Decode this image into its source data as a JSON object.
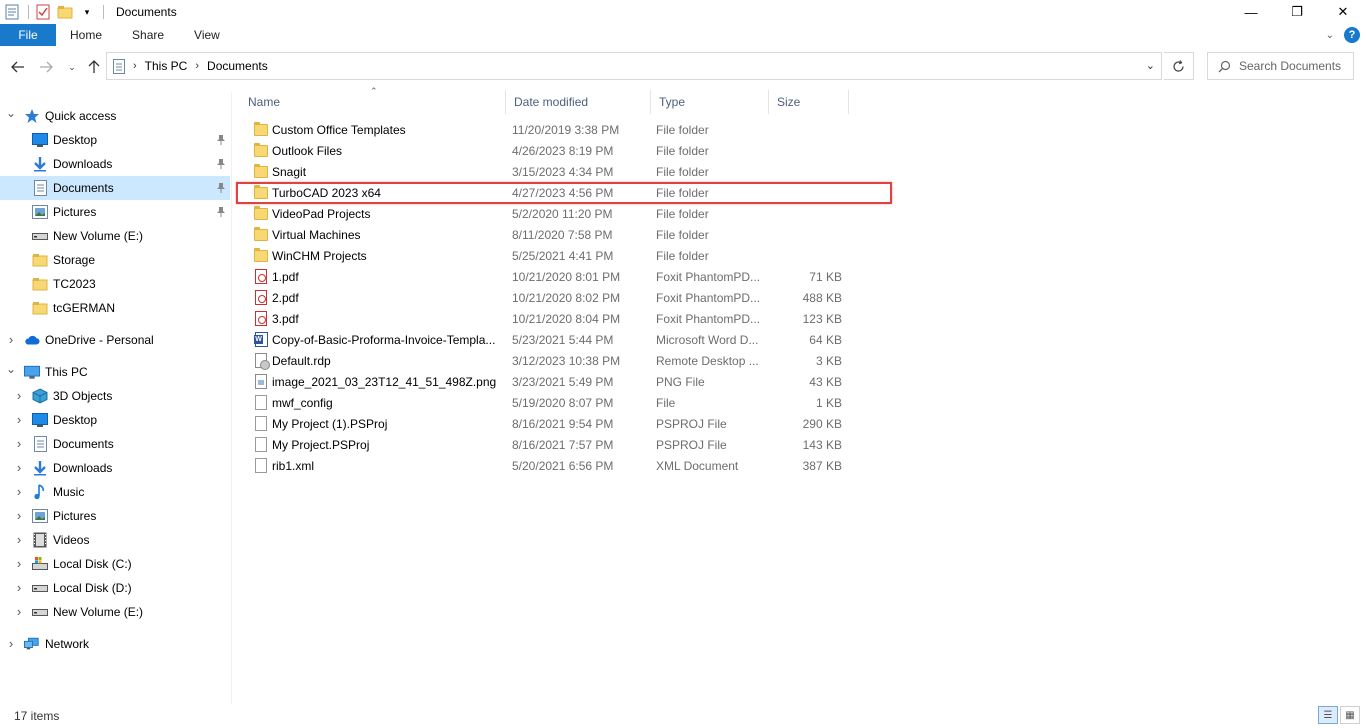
{
  "window": {
    "title": "Documents",
    "minimize": "—",
    "restore": "❐",
    "close": "✕"
  },
  "ribbon": {
    "tabs": [
      "File",
      "Home",
      "Share",
      "View"
    ],
    "help": "?"
  },
  "address": {
    "crumbs": [
      "This PC",
      "Documents"
    ],
    "search_placeholder": "Search Documents"
  },
  "navpane": {
    "items": [
      {
        "label": "Quick access",
        "icon": "star-icon",
        "level": 0,
        "expand": "open"
      },
      {
        "label": "Desktop",
        "icon": "desktop-icon",
        "level": 1,
        "pinned": true
      },
      {
        "label": "Downloads",
        "icon": "download-icon",
        "level": 1,
        "pinned": true
      },
      {
        "label": "Documents",
        "icon": "documents-icon",
        "level": 1,
        "pinned": true,
        "selected": true
      },
      {
        "label": "Pictures",
        "icon": "pictures-icon",
        "level": 1,
        "pinned": true
      },
      {
        "label": "New Volume (E:)",
        "icon": "drive-icon",
        "level": 1
      },
      {
        "label": "Storage",
        "icon": "folder-icon",
        "level": 1
      },
      {
        "label": "TC2023",
        "icon": "folder-icon",
        "level": 1
      },
      {
        "label": "tcGERMAN",
        "icon": "folder-icon",
        "level": 1
      },
      {
        "label": "OneDrive - Personal",
        "icon": "cloud-icon",
        "level": 0,
        "expand": "closed"
      },
      {
        "label": "This PC",
        "icon": "computer-icon",
        "level": 0,
        "expand": "open"
      },
      {
        "label": "3D Objects",
        "icon": "cube-icon",
        "level": 1,
        "expand": "closed"
      },
      {
        "label": "Desktop",
        "icon": "desktop-icon",
        "level": 1,
        "expand": "closed"
      },
      {
        "label": "Documents",
        "icon": "documents-icon",
        "level": 1,
        "expand": "closed"
      },
      {
        "label": "Downloads",
        "icon": "download-icon",
        "level": 1,
        "expand": "closed"
      },
      {
        "label": "Music",
        "icon": "music-icon",
        "level": 1,
        "expand": "closed"
      },
      {
        "label": "Pictures",
        "icon": "pictures-icon",
        "level": 1,
        "expand": "closed"
      },
      {
        "label": "Videos",
        "icon": "video-icon",
        "level": 1,
        "expand": "closed"
      },
      {
        "label": "Local Disk (C:)",
        "icon": "system-drive-icon",
        "level": 1,
        "expand": "closed"
      },
      {
        "label": "Local Disk (D:)",
        "icon": "drive-icon",
        "level": 1,
        "expand": "closed"
      },
      {
        "label": "New Volume (E:)",
        "icon": "drive-icon",
        "level": 1,
        "expand": "closed"
      },
      {
        "label": "Network",
        "icon": "network-icon",
        "level": 0,
        "expand": "closed"
      }
    ]
  },
  "columns": {
    "name": "Name",
    "date": "Date modified",
    "type": "Type",
    "size": "Size"
  },
  "files": [
    {
      "name": "Custom Office Templates",
      "date": "11/20/2019 3:38 PM",
      "type": "File folder",
      "size": "",
      "icon": "folder"
    },
    {
      "name": "Outlook Files",
      "date": "4/26/2023 8:19 PM",
      "type": "File folder",
      "size": "",
      "icon": "folder"
    },
    {
      "name": "Snagit",
      "date": "3/15/2023 4:34 PM",
      "type": "File folder",
      "size": "",
      "icon": "folder"
    },
    {
      "name": "TurboCAD 2023 x64",
      "date": "4/27/2023 4:56 PM",
      "type": "File folder",
      "size": "",
      "icon": "folder",
      "highlighted": true
    },
    {
      "name": "VideoPad Projects",
      "date": "5/2/2020 11:20 PM",
      "type": "File folder",
      "size": "",
      "icon": "folder"
    },
    {
      "name": "Virtual Machines",
      "date": "8/11/2020 7:58 PM",
      "type": "File folder",
      "size": "",
      "icon": "folder"
    },
    {
      "name": "WinCHM Projects",
      "date": "5/25/2021 4:41 PM",
      "type": "File folder",
      "size": "",
      "icon": "folder"
    },
    {
      "name": "1.pdf",
      "date": "10/21/2020 8:01 PM",
      "type": "Foxit PhantomPD...",
      "size": "71 KB",
      "icon": "pdf"
    },
    {
      "name": "2.pdf",
      "date": "10/21/2020 8:02 PM",
      "type": "Foxit PhantomPD...",
      "size": "488 KB",
      "icon": "pdf"
    },
    {
      "name": "3.pdf",
      "date": "10/21/2020 8:04 PM",
      "type": "Foxit PhantomPD...",
      "size": "123 KB",
      "icon": "pdf"
    },
    {
      "name": "Copy-of-Basic-Proforma-Invoice-Templa...",
      "date": "5/23/2021 5:44 PM",
      "type": "Microsoft Word D...",
      "size": "64 KB",
      "icon": "word"
    },
    {
      "name": "Default.rdp",
      "date": "3/12/2023 10:38 PM",
      "type": "Remote Desktop ...",
      "size": "3 KB",
      "icon": "rdp"
    },
    {
      "name": "image_2021_03_23T12_41_51_498Z.png",
      "date": "3/23/2021 5:49 PM",
      "type": "PNG File",
      "size": "43 KB",
      "icon": "image"
    },
    {
      "name": "mwf_config",
      "date": "5/19/2020 8:07 PM",
      "type": "File",
      "size": "1 KB",
      "icon": "doc"
    },
    {
      "name": "My Project (1).PSProj",
      "date": "8/16/2021 9:54 PM",
      "type": "PSPROJ File",
      "size": "290 KB",
      "icon": "doc"
    },
    {
      "name": "My Project.PSProj",
      "date": "8/16/2021 7:57 PM",
      "type": "PSPROJ File",
      "size": "143 KB",
      "icon": "doc"
    },
    {
      "name": "rib1.xml",
      "date": "5/20/2021 6:56 PM",
      "type": "XML Document",
      "size": "387 KB",
      "icon": "doc"
    }
  ],
  "status": {
    "count": "17 items"
  }
}
